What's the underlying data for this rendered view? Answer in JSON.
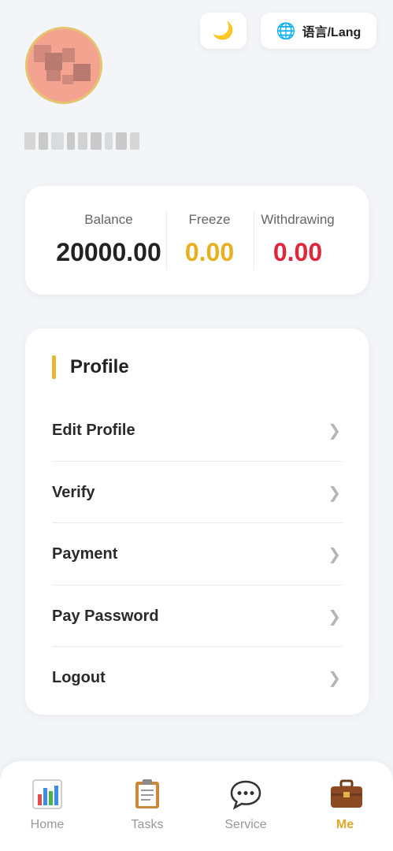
{
  "header": {
    "theme_icon": "moon-icon",
    "lang_icon": "globe-icon",
    "lang_label": "语言/Lang"
  },
  "balance": {
    "balance_label": "Balance",
    "balance_value": "20000.00",
    "freeze_label": "Freeze",
    "freeze_value": "0.00",
    "withdrawing_label": "Withdrawing",
    "withdrawing_value": "0.00",
    "colors": {
      "balance": "#222222",
      "freeze": "#e8b020",
      "withdrawing": "#e0263a"
    }
  },
  "profile": {
    "title": "Profile",
    "items": [
      {
        "label": "Edit Profile"
      },
      {
        "label": "Verify"
      },
      {
        "label": "Payment"
      },
      {
        "label": "Pay Password"
      },
      {
        "label": "Logout"
      }
    ]
  },
  "nav": {
    "items": [
      {
        "label": "Home",
        "icon": "bar-chart-icon",
        "active": false
      },
      {
        "label": "Tasks",
        "icon": "clipboard-icon",
        "active": false
      },
      {
        "label": "Service",
        "icon": "speech-bubble-icon",
        "active": false
      },
      {
        "label": "Me",
        "icon": "briefcase-icon",
        "active": true
      }
    ],
    "active_color": "#e2a82a"
  }
}
